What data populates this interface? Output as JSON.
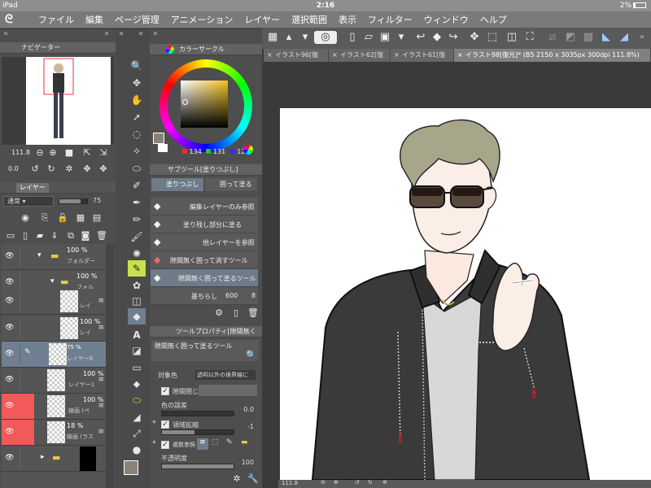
{
  "status": {
    "device": "iPad",
    "time": "2:16",
    "battery": "2%"
  },
  "menu": [
    "ファイル",
    "編集",
    "ページ管理",
    "アニメーション",
    "レイヤー",
    "選択範囲",
    "表示",
    "フィルター",
    "ウィンドウ",
    "ヘルプ"
  ],
  "navigator": {
    "title": "ナビゲーター",
    "zoom": "111.8",
    "angle": "0.0"
  },
  "layers": {
    "tab": "レイヤー",
    "blend": "通常",
    "opacity": "75",
    "rows": [
      {
        "pct": "100 %",
        "name": "フォルダー"
      },
      {
        "pct": "100 %",
        "name": "フォル"
      },
      {
        "pct": "",
        "name": "レイ"
      },
      {
        "pct": "100 %",
        "name": "レイ"
      },
      {
        "pct": "75 %",
        "name": "レイヤー6"
      },
      {
        "pct": "100 %",
        "name": "レイヤー1"
      },
      {
        "pct": "100 %",
        "name": "線画 (ペ"
      },
      {
        "pct": "18 %",
        "name": "線画 (ラス"
      },
      {
        "pct": "",
        "name": ""
      }
    ]
  },
  "color": {
    "title": "カラーサークル",
    "r": "134",
    "g": "131",
    "b": "123",
    "main": "#8a8276"
  },
  "subtool": {
    "title": "サブツール[塗りつぶし]",
    "tabs": [
      "塗りつぶし",
      "囲って塗る"
    ],
    "items": [
      "編集レイヤーのみ参照",
      "塗り残し部分に塗る",
      "他レイヤーを参照",
      "隙間無く囲って消すツール",
      "隙間無く囲って塗るツール"
    ],
    "brush_label": "墨ちらし",
    "brush_value": "600",
    "brush_extra": "8"
  },
  "toolprop": {
    "title": "ツールプロパティ[隙間無く",
    "tool_name": "隙間無く囲って塗るツール",
    "target_label": "対象色",
    "target_value": "透明以外の境界線に",
    "gap_label": "隙間閉じ",
    "tolerance_label": "色の誤差",
    "tolerance_value": "0.0",
    "expand_label": "領域拡縮",
    "expand_value": "-1",
    "multi_label": "複数参照",
    "opacity_label": "不透明度",
    "opacity_value": "100"
  },
  "tabs": [
    "イラスト96[復",
    "イラスト62[復",
    "イラスト61[復",
    "イラスト98[復元]* (B5 2150 x 3035px 300dpi 111.8%)"
  ],
  "bottom": {
    "zoom": "111.8"
  }
}
